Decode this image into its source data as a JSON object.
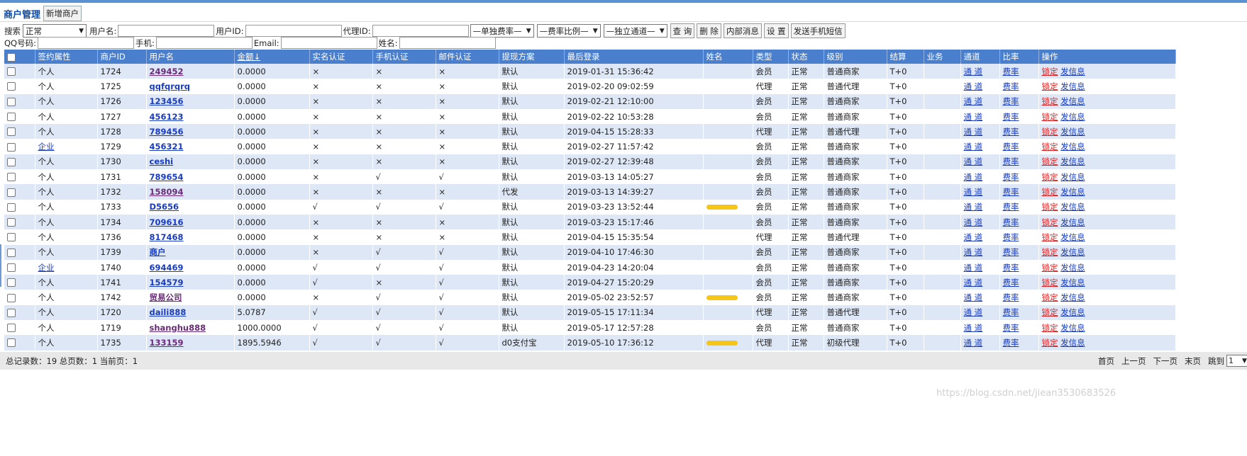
{
  "tabs": {
    "active": "商户管理",
    "new_merchant": "新增商户"
  },
  "search": {
    "label": "搜索",
    "status_value": "正常",
    "username_label": "用户名:",
    "userid_label": "用户ID:",
    "agentid_label": "代理ID:",
    "rate_single": "—单独费率—",
    "rate_ratio": "—费率比例—",
    "channel": "—独立通道—",
    "query_button": "查 询",
    "delete_button": "删 除",
    "internal_msg_button": "内部消息",
    "settings_button": "设 置",
    "sms_button": "发送手机短信",
    "qq_label": "QQ号码:",
    "phone_label": "手机:",
    "email_label": "Email:",
    "name_label": "姓名:"
  },
  "table": {
    "headers": [
      "签约属性",
      "商户ID",
      "用户名",
      "金额↓",
      "实名认证",
      "手机认证",
      "邮件认证",
      "提现方案",
      "最后登录",
      "姓名",
      "类型",
      "状态",
      "级别",
      "结算",
      "业务",
      "通道",
      "比率",
      "操作"
    ],
    "action_channel": "通 道",
    "action_rate": "费率",
    "action_lock": "锁定",
    "action_msg": "发信息",
    "rows": [
      {
        "sign": "个人",
        "id": "1724",
        "user": "249452",
        "amount": "0.0000",
        "realname": "×",
        "phone": "×",
        "email": "×",
        "plan": "默认",
        "login": "2019-01-31 15:36:42",
        "name": "",
        "type": "会员",
        "status": "正常",
        "level": "普通商家",
        "settle": "T+0",
        "biz": ""
      },
      {
        "sign": "个人",
        "id": "1725",
        "user": "qqfqrqrq",
        "amount": "0.0000",
        "realname": "×",
        "phone": "×",
        "email": "×",
        "plan": "默认",
        "login": "2019-02-20 09:02:59",
        "name": "",
        "type": "代理",
        "status": "正常",
        "level": "普通代理",
        "settle": "T+0",
        "biz": ""
      },
      {
        "sign": "个人",
        "id": "1726",
        "user": "123456",
        "amount": "0.0000",
        "realname": "×",
        "phone": "×",
        "email": "×",
        "plan": "默认",
        "login": "2019-02-21 12:10:00",
        "name": "",
        "type": "会员",
        "status": "正常",
        "level": "普通商家",
        "settle": "T+0",
        "biz": ""
      },
      {
        "sign": "个人",
        "id": "1727",
        "user": "456123",
        "amount": "0.0000",
        "realname": "×",
        "phone": "×",
        "email": "×",
        "plan": "默认",
        "login": "2019-02-22 10:53:28",
        "name": "",
        "type": "会员",
        "status": "正常",
        "level": "普通商家",
        "settle": "T+0",
        "biz": ""
      },
      {
        "sign": "个人",
        "id": "1728",
        "user": "789456",
        "amount": "0.0000",
        "realname": "×",
        "phone": "×",
        "email": "×",
        "plan": "默认",
        "login": "2019-04-15 15:28:33",
        "name": "",
        "type": "代理",
        "status": "正常",
        "level": "普通代理",
        "settle": "T+0",
        "biz": ""
      },
      {
        "sign": "企业",
        "id": "1729",
        "user": "456321",
        "amount": "0.0000",
        "realname": "×",
        "phone": "×",
        "email": "×",
        "plan": "默认",
        "login": "2019-02-27 11:57:42",
        "name": "",
        "type": "会员",
        "status": "正常",
        "level": "普通商家",
        "settle": "T+0",
        "biz": ""
      },
      {
        "sign": "个人",
        "id": "1730",
        "user": "ceshi",
        "amount": "0.0000",
        "realname": "×",
        "phone": "×",
        "email": "×",
        "plan": "默认",
        "login": "2019-02-27 12:39:48",
        "name": "",
        "type": "会员",
        "status": "正常",
        "level": "普通商家",
        "settle": "T+0",
        "biz": ""
      },
      {
        "sign": "个人",
        "id": "1731",
        "user": "789654",
        "amount": "0.0000",
        "realname": "×",
        "phone": "√",
        "email": "√",
        "plan": "默认",
        "login": "2019-03-13 14:05:27",
        "name": "",
        "type": "会员",
        "status": "正常",
        "level": "普通商家",
        "settle": "T+0",
        "biz": ""
      },
      {
        "sign": "个人",
        "id": "1732",
        "user": "158094",
        "amount": "0.0000",
        "realname": "×",
        "phone": "×",
        "email": "×",
        "plan": "代发",
        "login": "2019-03-13 14:39:27",
        "name": "",
        "type": "会员",
        "status": "正常",
        "level": "普通商家",
        "settle": "T+0",
        "biz": ""
      },
      {
        "sign": "个人",
        "id": "1733",
        "user": "D5656",
        "amount": "0.0000",
        "realname": "√",
        "phone": "√",
        "email": "√",
        "plan": "默认",
        "login": "2019-03-23 13:52:44",
        "name": "redacted",
        "type": "会员",
        "status": "正常",
        "level": "普通商家",
        "settle": "T+0",
        "biz": ""
      },
      {
        "sign": "个人",
        "id": "1734",
        "user": "709616",
        "amount": "0.0000",
        "realname": "×",
        "phone": "×",
        "email": "×",
        "plan": "默认",
        "login": "2019-03-23 15:17:46",
        "name": "",
        "type": "会员",
        "status": "正常",
        "level": "普通商家",
        "settle": "T+0",
        "biz": ""
      },
      {
        "sign": "个人",
        "id": "1736",
        "user": "817468",
        "amount": "0.0000",
        "realname": "×",
        "phone": "×",
        "email": "×",
        "plan": "默认",
        "login": "2019-04-15 15:35:54",
        "name": "",
        "type": "代理",
        "status": "正常",
        "level": "普通代理",
        "settle": "T+0",
        "biz": ""
      },
      {
        "sign": "个人",
        "id": "1739",
        "user": "商户",
        "amount": "0.0000",
        "realname": "×",
        "phone": "√",
        "email": "√",
        "plan": "默认",
        "login": "2019-04-10 17:46:30",
        "name": "",
        "type": "会员",
        "status": "正常",
        "level": "普通商家",
        "settle": "T+0",
        "biz": ""
      },
      {
        "sign": "企业",
        "id": "1740",
        "user": "694469",
        "amount": "0.0000",
        "realname": "√",
        "phone": "√",
        "email": "√",
        "plan": "默认",
        "login": "2019-04-23 14:20:04",
        "name": "",
        "type": "会员",
        "status": "正常",
        "level": "普通商家",
        "settle": "T+0",
        "biz": ""
      },
      {
        "sign": "个人",
        "id": "1741",
        "user": "154579",
        "amount": "0.0000",
        "realname": "√",
        "phone": "×",
        "email": "√",
        "plan": "默认",
        "login": "2019-04-27 15:20:29",
        "name": "",
        "type": "会员",
        "status": "正常",
        "level": "普通商家",
        "settle": "T+0",
        "biz": ""
      },
      {
        "sign": "个人",
        "id": "1742",
        "user": "贸易公司",
        "amount": "0.0000",
        "realname": "×",
        "phone": "√",
        "email": "√",
        "plan": "默认",
        "login": "2019-05-02 23:52:57",
        "name": "redacted",
        "type": "会员",
        "status": "正常",
        "level": "普通商家",
        "settle": "T+0",
        "biz": ""
      },
      {
        "sign": "个人",
        "id": "1720",
        "user": "daili888",
        "amount": "5.0787",
        "realname": "√",
        "phone": "√",
        "email": "√",
        "plan": "默认",
        "login": "2019-05-15 17:11:34",
        "name": "",
        "type": "代理",
        "status": "正常",
        "level": "普通代理",
        "settle": "T+0",
        "biz": ""
      },
      {
        "sign": "个人",
        "id": "1719",
        "user": "shanghu888",
        "amount": "1000.0000",
        "realname": "√",
        "phone": "√",
        "email": "√",
        "plan": "默认",
        "login": "2019-05-17 12:57:28",
        "name": "",
        "type": "会员",
        "status": "正常",
        "level": "普通商家",
        "settle": "T+0",
        "biz": ""
      },
      {
        "sign": "个人",
        "id": "1735",
        "user": "133159",
        "amount": "1895.5946",
        "realname": "√",
        "phone": "√",
        "email": "√",
        "plan": "d0支付宝",
        "login": "2019-05-10 17:36:12",
        "name": "redacted",
        "type": "代理",
        "status": "正常",
        "level": "初级代理",
        "settle": "T+0",
        "biz": ""
      }
    ]
  },
  "footer": {
    "summary": "总记录数：19 总页数：1 当前页：1",
    "first": "首页",
    "prev": "上一页",
    "next": "下一页",
    "last": "末页",
    "jump": "跳到",
    "page_value": "1",
    "page_suffix": "页"
  },
  "watermark": "https://blog.csdn.net/jiean3530683526"
}
